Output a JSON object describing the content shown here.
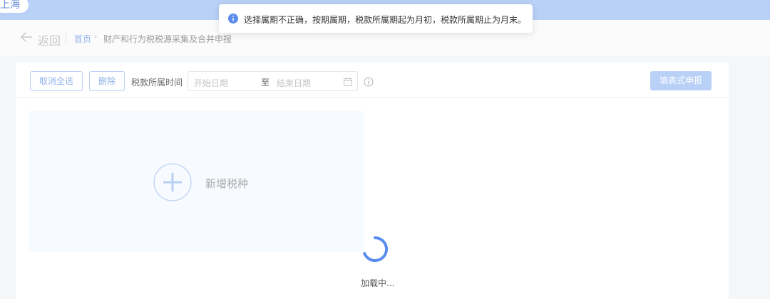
{
  "header": {
    "region": "上海",
    "accent_color": "#b9d0f7"
  },
  "nav": {
    "back_label": "返回",
    "breadcrumb": {
      "home": "首页",
      "separator": "›",
      "current": "财产和行为税税源采集及合并申报"
    }
  },
  "toast": {
    "icon": "info-icon",
    "message": "选择属期不正确，按期属期，税款所属期起为月初，税款所属期止为月末。"
  },
  "toolbar": {
    "cancel_all_label": "取消全选",
    "delete_label": "删除",
    "period_label": "税款所属时间",
    "start_placeholder": "开始日期",
    "range_separator": "至",
    "end_placeholder": "结束日期",
    "submit_label": "填表式申报"
  },
  "add_tile": {
    "label": "新增税种"
  },
  "loading": {
    "text": "加载中..."
  }
}
